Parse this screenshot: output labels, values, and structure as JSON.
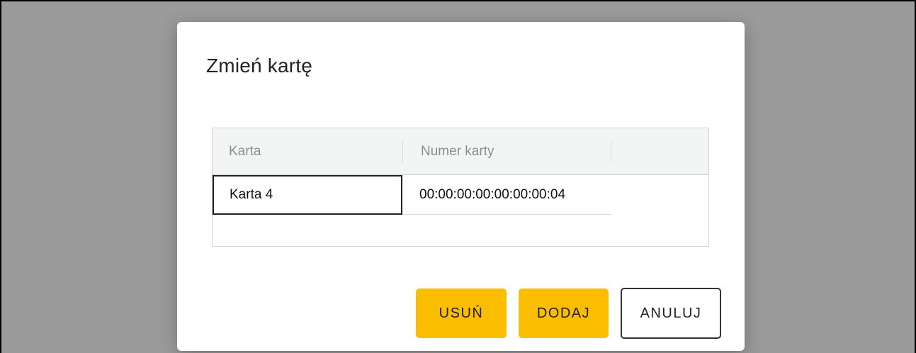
{
  "dialog": {
    "title": "Zmień kartę"
  },
  "table": {
    "columns": [
      "Karta",
      "Numer karty"
    ],
    "rows": [
      {
        "karta": "Karta 4",
        "numer": "00:00:00:00:00:00:00:04"
      }
    ]
  },
  "buttons": {
    "delete_label": "USUŃ",
    "add_label": "DODAJ",
    "cancel_label": "ANULUJ"
  },
  "colors": {
    "accent": "#fbbd00",
    "backdrop": "#9a9a9a",
    "header_bg": "#f3f5f5"
  }
}
